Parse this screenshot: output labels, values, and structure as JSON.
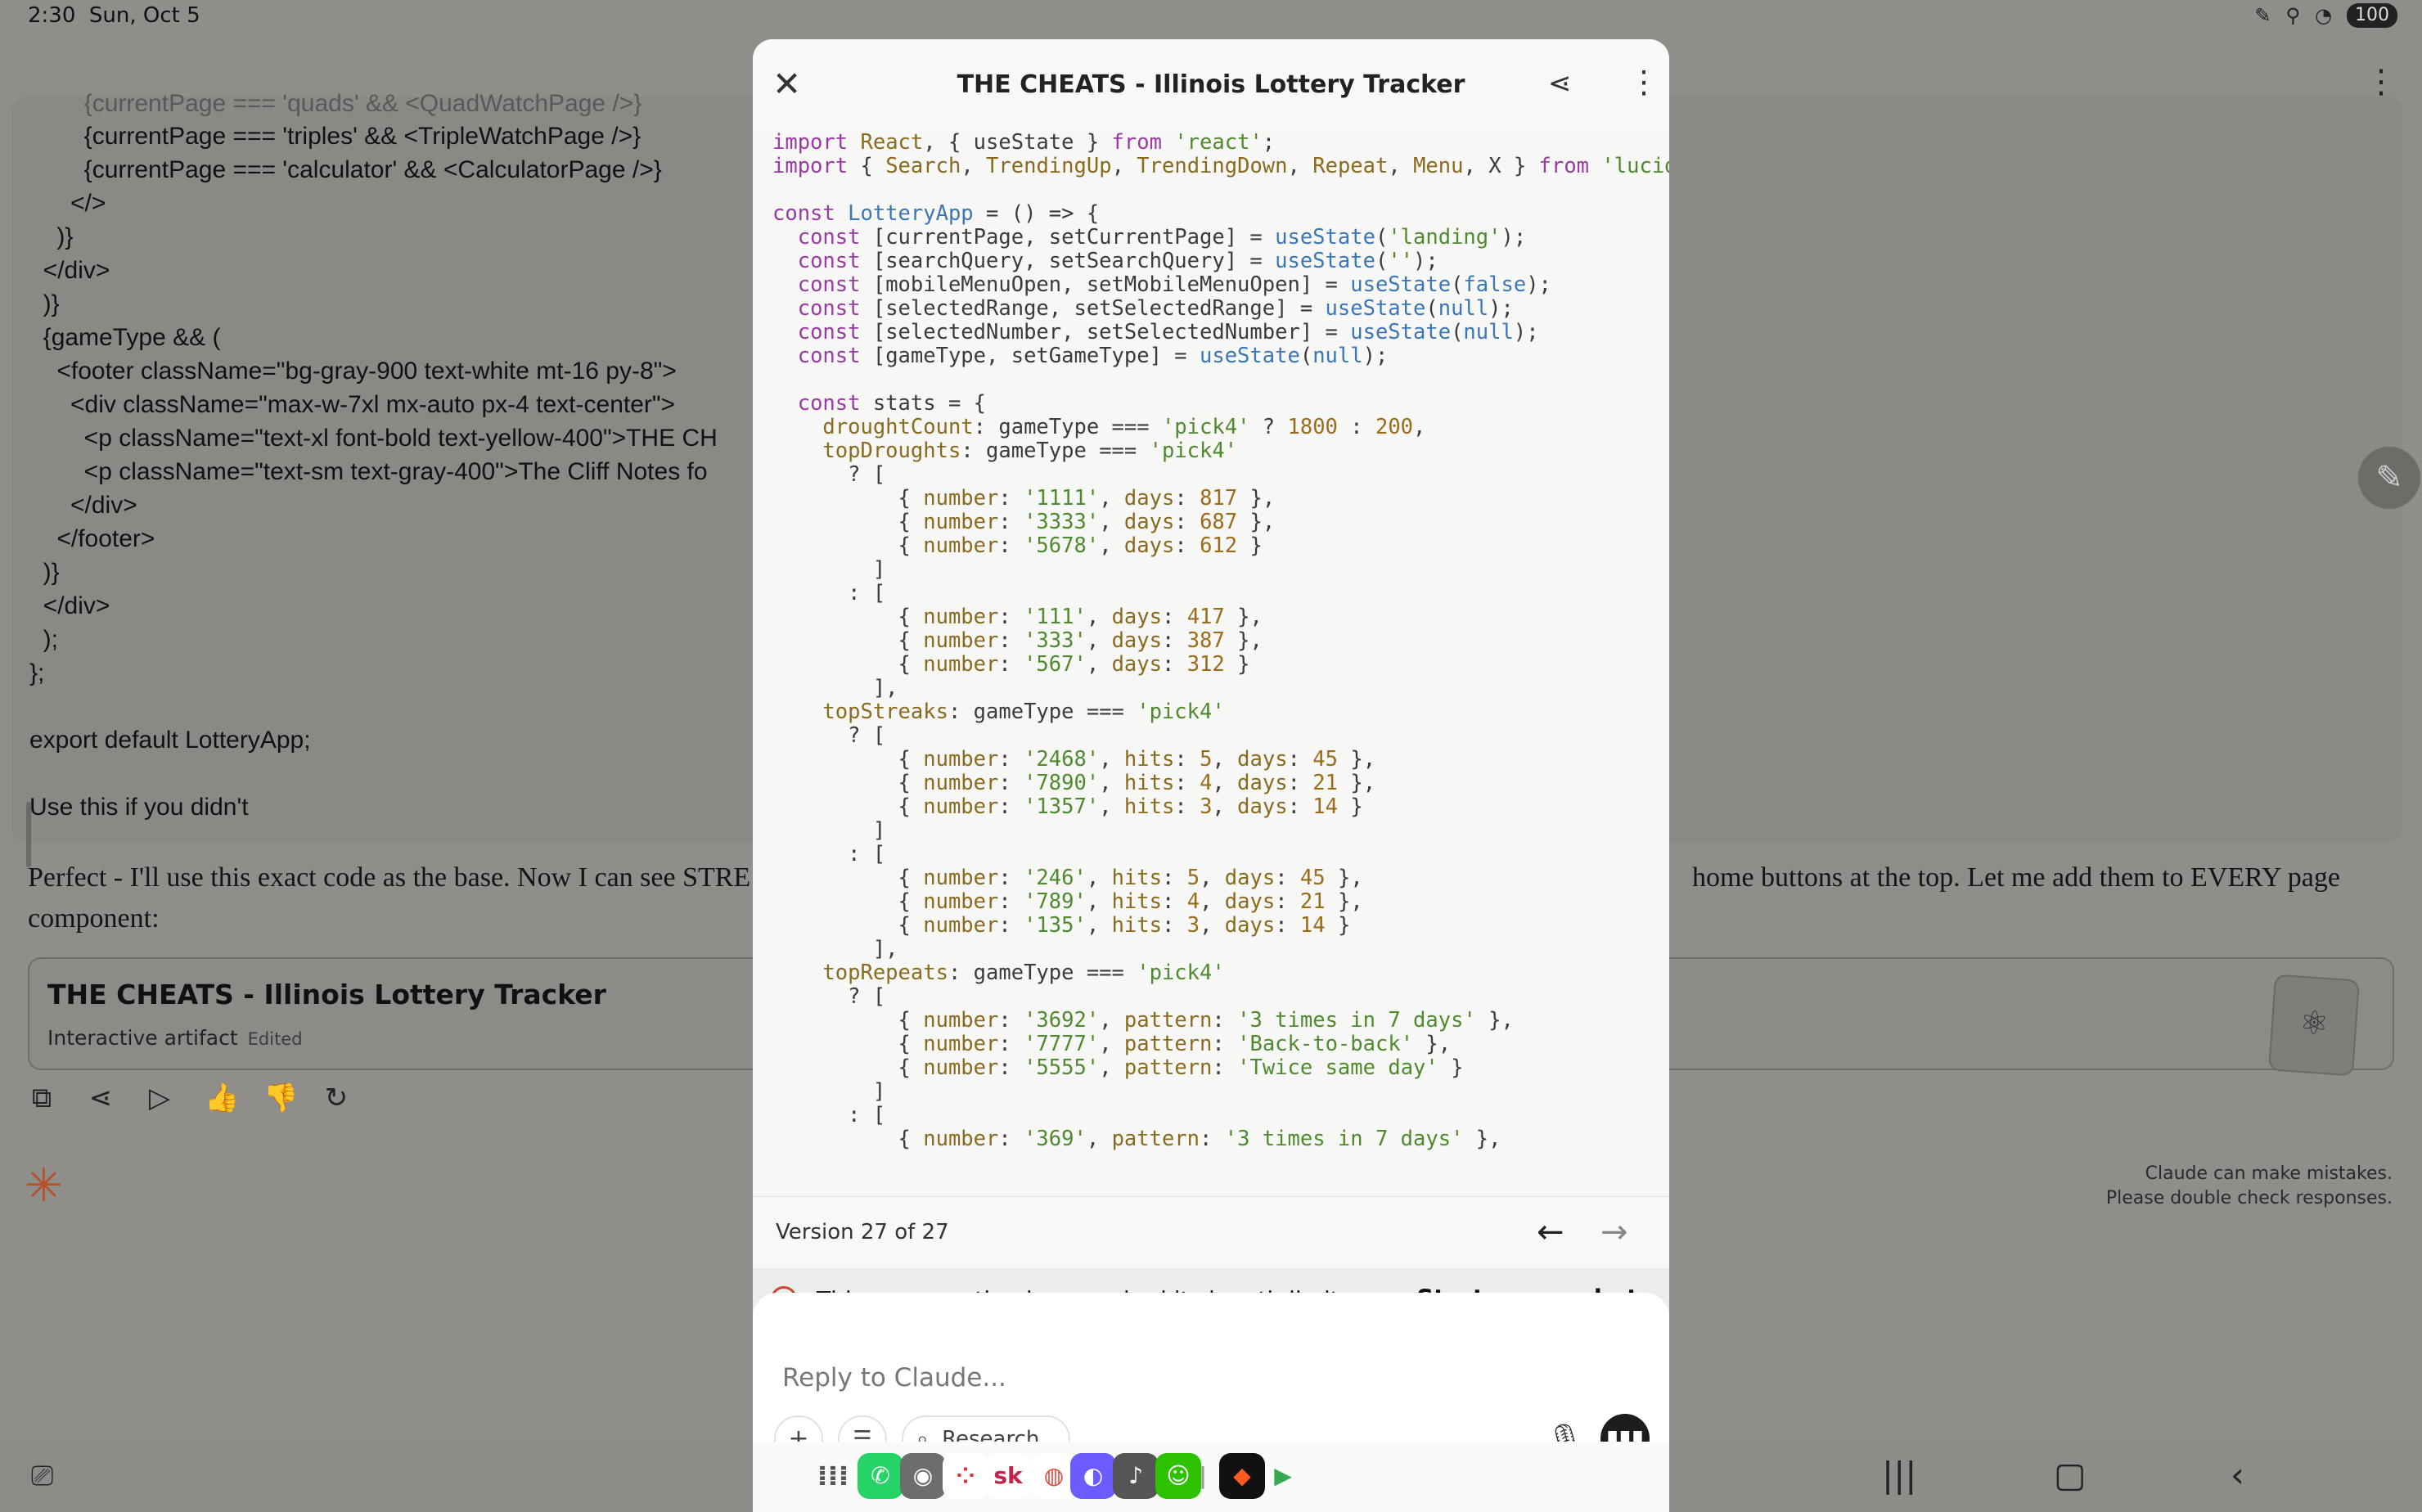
{
  "status_bar": {
    "time": "2:30",
    "date": "Sun, Oct 5",
    "battery": "100"
  },
  "background_chat": {
    "code_lines_faded": "        {currentPage === 'quads' && <QuadWatchPage />}",
    "code_lines": [
      "        {currentPage === 'triples' && <TripleWatchPage />}",
      "        {currentPage === 'calculator' && <CalculatorPage />}",
      "      </>",
      "    )}",
      "  </div>",
      "  )}",
      "  {gameType && (",
      "    <footer className=\"bg-gray-900 text-white mt-16 py-8\">",
      "      <div className=\"max-w-7xl mx-auto px-4 text-center\">",
      "        <p className=\"text-xl font-bold text-yellow-400\">THE CH",
      "        <p className=\"text-sm text-gray-400\">The Cliff Notes fo",
      "      </div>",
      "    </footer>",
      "  )}",
      "  </div>",
      "  );",
      "};",
      "",
      "export default LotteryApp;",
      "",
      "Use this if you didn't"
    ],
    "assistant_left": "Perfect - I'll use this exact code as the base. Now I can see STRE",
    "assistant_right": "home buttons at the top. Let me add them to EVERY page",
    "assistant_line2": "component:",
    "artifact_title": "THE CHEATS - Illinois Lottery Tracker",
    "artifact_sub": "Interactive artifact",
    "artifact_edited": "Edited",
    "disclaimer_1": "Claude can make mistakes.",
    "disclaimer_2": "Please double check responses."
  },
  "modal": {
    "title": "THE CHEATS - Illinois Lottery Tracker",
    "version_label": "Version 27 of 27",
    "limit_pre": "This conversation has reached its ",
    "limit_link": "length limit",
    "limit_post": ".",
    "new_chat": "Start a new chat",
    "reply_placeholder": "Reply to Claude...",
    "research_label": "Research"
  },
  "icons": {
    "close": "close-icon",
    "share": "share-icon",
    "more": "more-vertical-icon",
    "prev": "arrow-left-icon",
    "next": "arrow-right-icon",
    "info": "info-icon",
    "plus": "plus-icon",
    "tools": "sliders-icon",
    "search": "search-icon",
    "mic": "microphone-icon",
    "voice": "voice-waveform-icon"
  },
  "colors": {
    "accent": "#b5512b",
    "limit_info": "#c8463a",
    "keyword": "#9a3aa3",
    "function": "#3b76b6",
    "string": "#4f8a2f"
  }
}
